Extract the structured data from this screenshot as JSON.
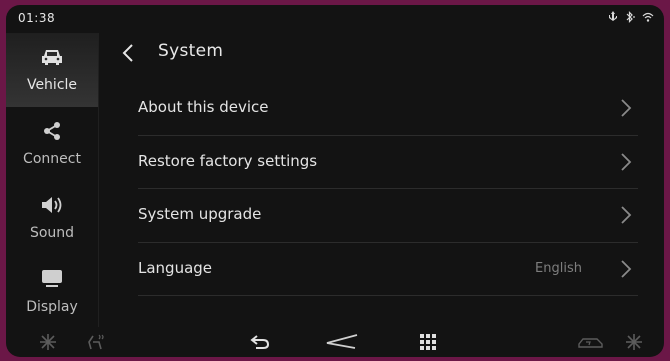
{
  "status": {
    "time": "01:38"
  },
  "sidebar": {
    "items": [
      {
        "label": "Vehicle",
        "icon": "car-icon",
        "active": true
      },
      {
        "label": "Connect",
        "icon": "share-icon",
        "active": false
      },
      {
        "label": "Sound",
        "icon": "speaker-icon",
        "active": false
      },
      {
        "label": "Display",
        "icon": "display-icon",
        "active": false
      }
    ]
  },
  "header": {
    "title": "System"
  },
  "settings": {
    "items": [
      {
        "label": "About this device",
        "value": ""
      },
      {
        "label": "Restore factory settings",
        "value": ""
      },
      {
        "label": "System upgrade",
        "value": ""
      },
      {
        "label": "Language",
        "value": "English"
      }
    ]
  },
  "bottombar": {
    "icons": [
      "fan-left-icon",
      "seat-heat-icon",
      "back-arrow-icon",
      "home-logo-icon",
      "app-grid-icon",
      "car-climate-icon",
      "fan-right-icon"
    ]
  },
  "colors": {
    "frame": "#6b1747",
    "background": "#131313",
    "text": "#e4e4e4",
    "muted": "#7e7e7e"
  }
}
